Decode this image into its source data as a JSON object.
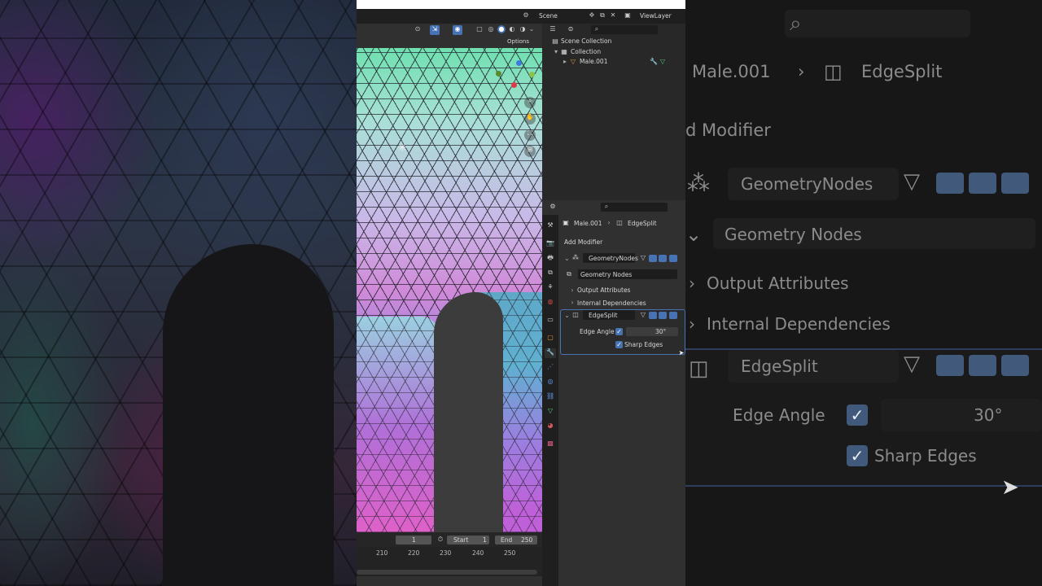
{
  "header": {
    "scene": "Scene",
    "view_layer": "ViewLayer"
  },
  "viewport": {
    "options_label": "Options"
  },
  "outliner": {
    "items": [
      {
        "label": "Scene Collection"
      },
      {
        "label": "Collection"
      },
      {
        "label": "Male.001"
      }
    ]
  },
  "properties": {
    "breadcrumb_object": "Male.001",
    "breadcrumb_modifier": "EdgeSplit",
    "add_modifier": "Add Modifier",
    "modifiers": [
      {
        "name": "GeometryNodes",
        "node_group": "Geometry Nodes"
      },
      {
        "name": "EdgeSplit"
      }
    ],
    "sub_panels": [
      "Output Attributes",
      "Internal Dependencies"
    ],
    "edge_angle_label": "Edge Angle",
    "edge_angle_value": "30°",
    "sharp_edges_label": "Sharp Edges"
  },
  "timeline": {
    "current_frame": "1",
    "start_label": "Start",
    "start_value": "1",
    "end_label": "End",
    "end_value": "250",
    "ticks": [
      "210",
      "220",
      "230",
      "240",
      "250"
    ]
  },
  "zoom": {
    "breadcrumb_object": "Male.001",
    "breadcrumb_modifier": "EdgeSplit",
    "add_modifier_partial": "d Modifier",
    "geometry_nodes": "GeometryNodes",
    "geometry_nodes_group": "Geometry Nodes",
    "output_attributes": "Output Attributes",
    "internal_dependencies": "Internal Dependencies",
    "edge_split": "EdgeSplit",
    "edge_angle_label": "Edge Angle",
    "edge_angle_value": "30°",
    "sharp_edges_label": "Sharp Edges"
  }
}
